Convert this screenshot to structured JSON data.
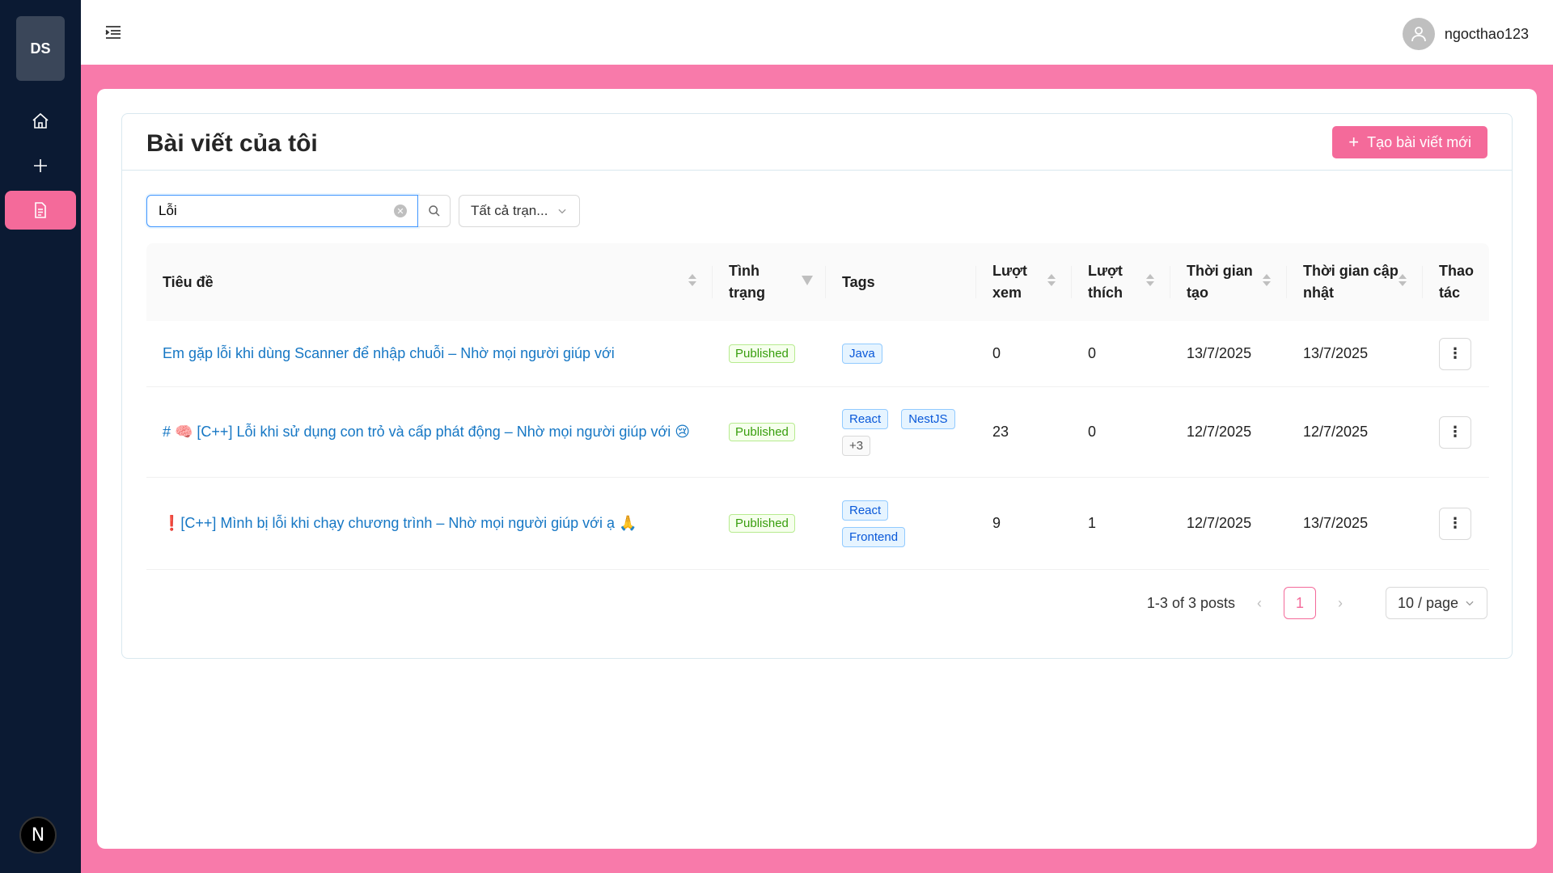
{
  "sidebar": {
    "logo": "DS",
    "items": [
      {
        "icon": "home-icon"
      },
      {
        "icon": "plus-icon"
      },
      {
        "icon": "document-icon",
        "active": true
      }
    ],
    "badge": "N"
  },
  "header": {
    "username": "ngocthao123"
  },
  "page": {
    "title": "Bài viết của tôi",
    "create_button": "Tạo bài viết mới"
  },
  "toolbar": {
    "search_value": "Lỗi",
    "status_filter": "Tất cả trạn..."
  },
  "table": {
    "columns": [
      "Tiêu đề",
      "Tình trạng",
      "Tags",
      "Lượt xem",
      "Lượt thích",
      "Thời gian tạo",
      "Thời gian cập nhật",
      "Thao tác"
    ],
    "rows": [
      {
        "title": "Em gặp lỗi khi dùng Scanner để nhập chuỗi – Nhờ mọi người giúp với",
        "status": "Published",
        "tags": [
          "Java"
        ],
        "views": "0",
        "likes": "0",
        "created": "13/7/2025",
        "updated": "13/7/2025",
        "action": "⋮"
      },
      {
        "title": "# 🧠 [C++] Lỗi khi sử dụng con trỏ và cấp phát động – Nhờ mọi người giúp với 😢",
        "status": "Published",
        "tags": [
          "React",
          "NestJS"
        ],
        "more_tags": "+3",
        "views": "23",
        "likes": "0",
        "created": "12/7/2025",
        "updated": "12/7/2025",
        "action": "⋮"
      },
      {
        "title": "❗[C++] Mình bị lỗi khi chạy chương trình – Nhờ mọi người giúp với ạ 🙏",
        "status": "Published",
        "tags": [
          "React",
          "Frontend"
        ],
        "views": "9",
        "likes": "1",
        "created": "12/7/2025",
        "updated": "13/7/2025",
        "action": "⋮"
      }
    ]
  },
  "pagination": {
    "summary": "1-3 of 3 posts",
    "current_page": "1",
    "page_size": "10 / page",
    "prev": "‹",
    "next": "›"
  },
  "colors": {
    "accent": "#f46a9a",
    "sidebar_bg": "#0b1a33",
    "page_bg": "#f87aaa",
    "link": "#1677c4"
  }
}
